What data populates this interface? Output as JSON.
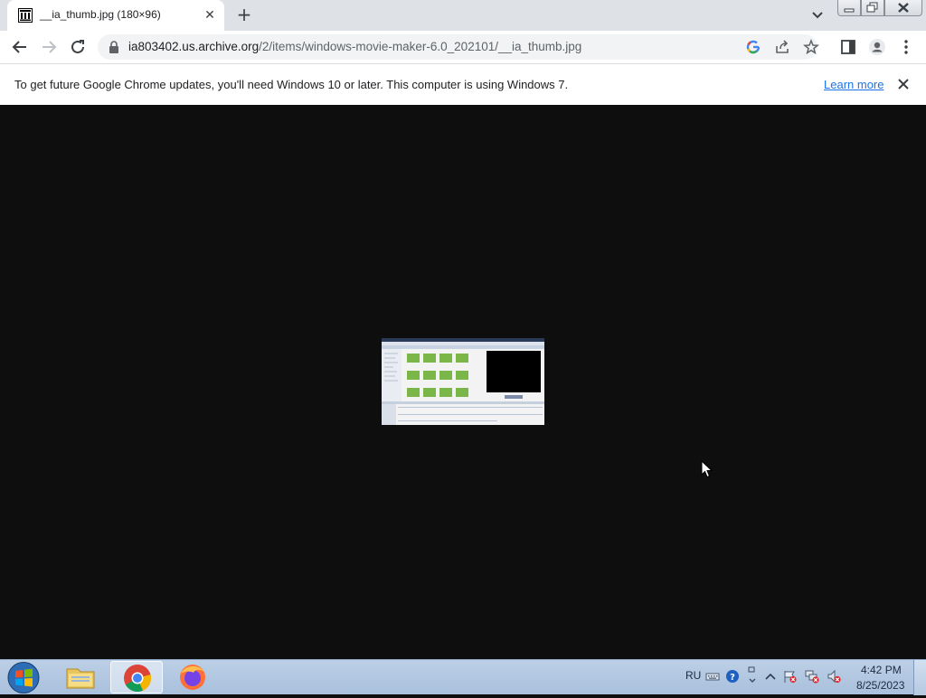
{
  "browser": {
    "tab": {
      "title": "__ia_thumb.jpg (180×96)",
      "favicon": "archive-icon"
    },
    "url": {
      "host": "ia803402.us.archive.org",
      "path": "/2/items/windows-movie-maker-6.0_202101/__ia_thumb.jpg"
    },
    "infobar": {
      "message": "To get future Google Chrome updates, you'll need Windows 10 or later. This computer is using Windows 7.",
      "link": "Learn more"
    }
  },
  "taskbar": {
    "apps": [
      "windows-explorer",
      "google-chrome",
      "firefox"
    ],
    "language": "RU",
    "time": "4:42 PM",
    "date": "8/25/2023"
  },
  "colors": {
    "accent": "#1a73e8",
    "page_background": "#0e0e0e"
  }
}
